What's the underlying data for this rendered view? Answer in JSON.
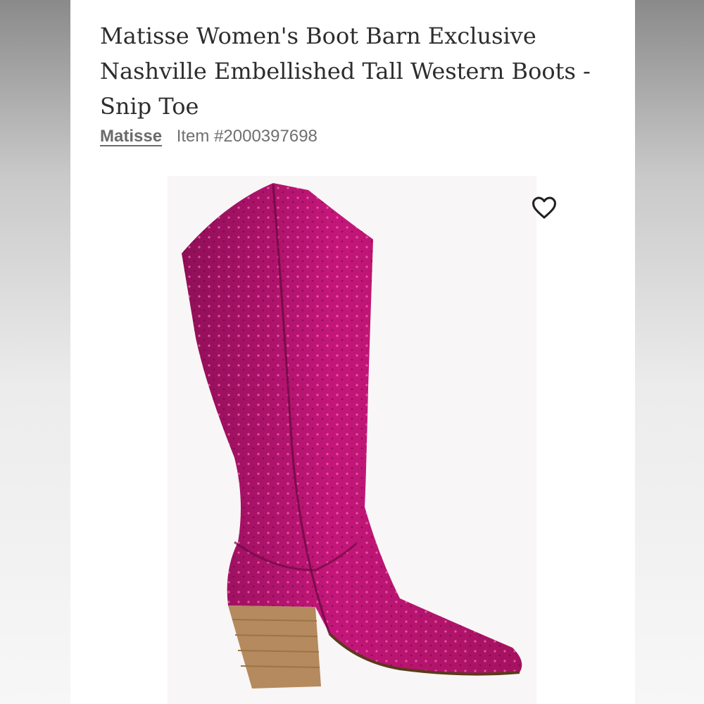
{
  "product": {
    "title": "Matisse Women's Boot Barn Exclusive Nashville Embellished Tall Western Boots - Snip Toe",
    "brand": "Matisse",
    "item_number": "Item #2000397698"
  },
  "icons": {
    "wishlist": "heart-outline-icon"
  },
  "colors": {
    "boot_primary": "#c4167a",
    "boot_shadow": "#7a0b4a",
    "heel": "#b48a5e"
  }
}
